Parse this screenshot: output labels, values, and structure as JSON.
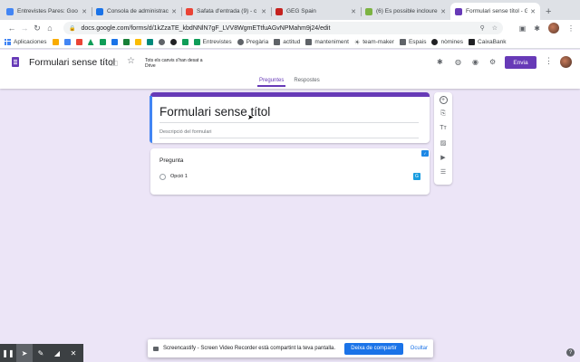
{
  "browser": {
    "tabs": [
      {
        "title": "Entrevistes Pares: Goo",
        "favicon_color": "#4285f4",
        "active": false
      },
      {
        "title": "Consola de administraci",
        "favicon_color": "#1a73e8",
        "active": false
      },
      {
        "title": "Safata d'entrada (9) - c",
        "favicon_color": "#ea4335",
        "active": false
      },
      {
        "title": "GEG Spain",
        "favicon_color": "#c5221f",
        "active": false
      },
      {
        "title": "(6) Es possible incloure",
        "favicon_color": "#7cb342",
        "active": false
      },
      {
        "title": "Formulari sense títol - G",
        "favicon_color": "#673ab7",
        "active": true
      }
    ],
    "new_tab_label": "+",
    "url": "docs.google.com/forms/d/1kZzaTE_kbdNNlN7gF_LVV8WgmETtfuAGvNPMahm9j24/edit",
    "bookmarks": [
      {
        "label": "Aplicaciones",
        "icon": "grid",
        "color": "#4285f4"
      },
      {
        "label": "",
        "icon": "folder",
        "color": "#f9ab00"
      },
      {
        "label": "",
        "icon": "docs",
        "color": "#4285f4"
      },
      {
        "label": "",
        "icon": "gmail",
        "color": "#ea4335"
      },
      {
        "label": "",
        "icon": "drive",
        "color": "#0f9d58"
      },
      {
        "label": "",
        "icon": "classroom",
        "color": "#0f9d58"
      },
      {
        "label": "",
        "icon": "calendar",
        "color": "#1a73e8"
      },
      {
        "label": "",
        "icon": "sites",
        "color": "#188038"
      },
      {
        "label": "",
        "icon": "keep",
        "color": "#fbbc04"
      },
      {
        "label": "",
        "icon": "meet",
        "color": "#00897b"
      },
      {
        "label": "",
        "icon": "shield",
        "color": "#5f6368"
      },
      {
        "label": "",
        "icon": "github",
        "color": "#202124"
      },
      {
        "label": "",
        "icon": "sheets",
        "color": "#0f9d58"
      },
      {
        "label": "Entrevistes",
        "icon": "sheets",
        "color": "#0f9d58"
      },
      {
        "label": "Pregària",
        "icon": "globe",
        "color": "#5f6368"
      },
      {
        "label": "actitud",
        "icon": "folder",
        "color": "#5f6368"
      },
      {
        "label": "manteniment",
        "icon": "folder",
        "color": "#5f6368"
      },
      {
        "label": "team-maker",
        "icon": "bulb",
        "color": "#5f6368"
      },
      {
        "label": "Espais",
        "icon": "card",
        "color": "#5f6368"
      },
      {
        "label": "nòmines",
        "icon": "circle",
        "color": "#202124"
      },
      {
        "label": "CaixaBank",
        "icon": "caixa",
        "color": "#202124"
      }
    ]
  },
  "forms_header": {
    "doc_title": "Formulari sense títol",
    "saved_message": "Tots els canvis s'han desat a Drive",
    "send_label": "Envia",
    "tabs": [
      "Preguntes",
      "Respostes"
    ],
    "active_tab": "Preguntes"
  },
  "form": {
    "title": "Formulari sense títol",
    "description_placeholder": "Descripció del formulari",
    "question": {
      "label": "Pregunta",
      "option": "Opció 1"
    }
  },
  "screencastify": {
    "message": "Screencastify - Screen Video Recorder està compartint la teva pantalla.",
    "stop_label": "Deixa de compartir",
    "hide_label": "Ocultar"
  },
  "help_label": "?",
  "colors": {
    "accent": "#673ab7",
    "background": "#ece5f7",
    "link": "#1a73e8"
  }
}
